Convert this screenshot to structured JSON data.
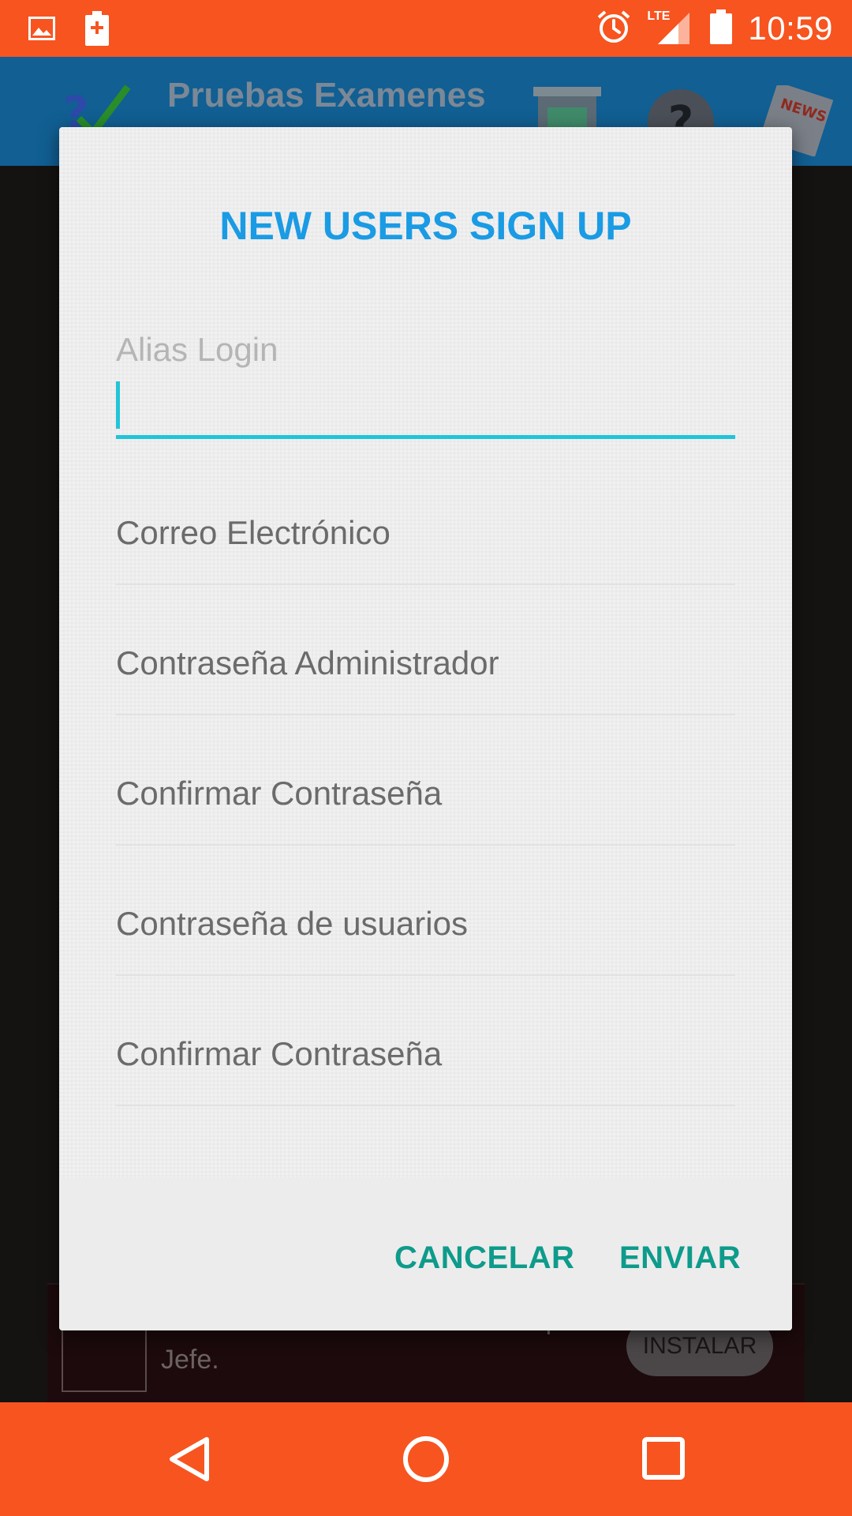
{
  "status_bar": {
    "time": "10:59",
    "network": "LTE"
  },
  "app_bar": {
    "title": "Pruebas Examenes"
  },
  "dialog": {
    "title": "NEW USERS SIGN UP",
    "fields": [
      {
        "label": "Alias Login",
        "focused": true
      },
      {
        "label": "Correo Electrónico"
      },
      {
        "label": "Contraseña Administrador"
      },
      {
        "label": "Confirmar Contraseña"
      },
      {
        "label": "Contraseña de usuarios"
      },
      {
        "label": "Confirmar Contraseña"
      }
    ],
    "buttons": {
      "cancel": "CANCELAR",
      "send": "ENVIAR"
    }
  },
  "ad": {
    "text": "Establece Tu Horario. Se Tu Propio Jefe.",
    "install": "INSTALAR"
  },
  "colors": {
    "status_bar": "#f75420",
    "app_bar": "#115f93",
    "title_blue": "#1a9be4",
    "focus_cyan": "#22c4d8",
    "button_teal": "#0e9b8b"
  }
}
